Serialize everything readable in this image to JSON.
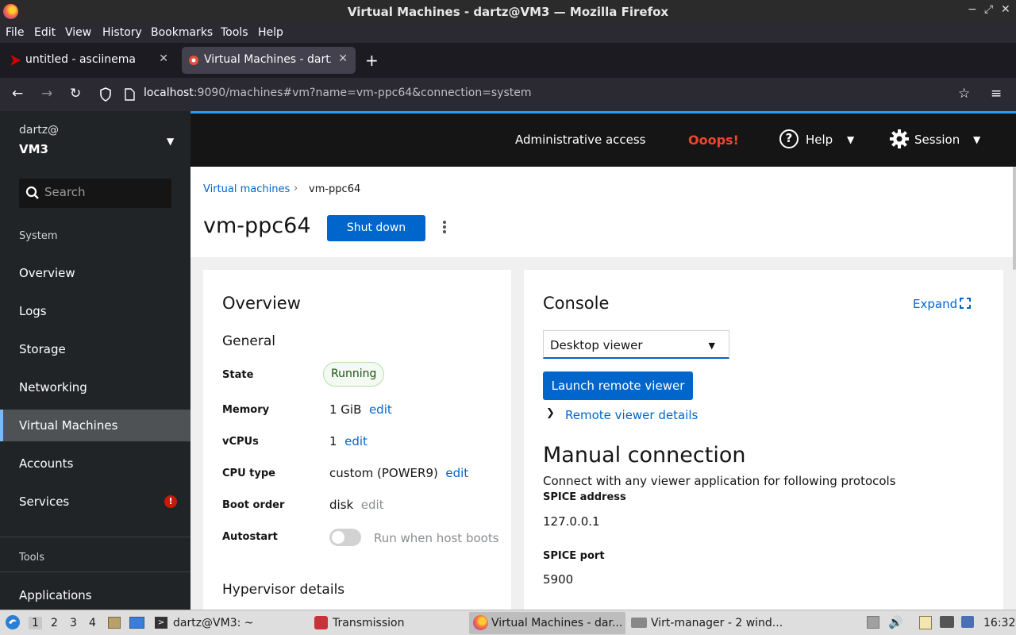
{
  "window": {
    "title": "Virtual Machines - dartz@VM3 — Mozilla Firefox",
    "controls": [
      "−",
      "⤢",
      "✕"
    ]
  },
  "menubar": [
    "File",
    "Edit",
    "View",
    "History",
    "Bookmarks",
    "Tools",
    "Help"
  ],
  "tabs": [
    {
      "label": "untitled - asciinema",
      "active": false
    },
    {
      "label": "Virtual Machines - dartz@",
      "active": true
    }
  ],
  "nav": {
    "url_host": "localhost",
    "url_rest": ":9090/machines#vm?name=vm-ppc64&connection=system"
  },
  "sidebar": {
    "user": "dartz@",
    "host": "VM3",
    "search_placeholder": "Search",
    "section_system": "System",
    "items": [
      "Overview",
      "Logs",
      "Storage",
      "Networking",
      "Virtual Machines",
      "Accounts",
      "Services"
    ],
    "active_item": "Virtual Machines",
    "services_alert": "!",
    "section_tools": "Tools",
    "tools_items": [
      "Applications"
    ]
  },
  "masthead": {
    "admin": "Administrative access",
    "oops": "Ooops!",
    "help": "Help",
    "session": "Session"
  },
  "page": {
    "breadcrumb_link": "Virtual machines",
    "breadcrumb_current": "vm-ppc64",
    "title": "vm-ppc64",
    "shutdown_button": "Shut down"
  },
  "overview": {
    "title": "Overview",
    "general": "General",
    "state_label": "State",
    "state_value": "Running",
    "memory_label": "Memory",
    "memory_value": "1 GiB",
    "vcpus_label": "vCPUs",
    "vcpus_value": "1",
    "cputype_label": "CPU type",
    "cputype_value": "custom (POWER9)",
    "boot_label": "Boot order",
    "boot_value": "disk",
    "autostart_label": "Autostart",
    "autostart_text": "Run when host boots",
    "edit": "edit",
    "hypervisor": "Hypervisor details"
  },
  "console": {
    "title": "Console",
    "expand": "Expand",
    "viewer_select": "Desktop viewer",
    "launch_button": "Launch remote viewer",
    "remote_details": "Remote viewer details",
    "manual_title": "Manual connection",
    "manual_desc": "Connect with any viewer application for following protocols",
    "spice_address_label": "SPICE address",
    "spice_address": "127.0.0.1",
    "spice_port_label": "SPICE port",
    "spice_port": "5900"
  },
  "taskbar": {
    "workspaces": [
      "1",
      "2",
      "3",
      "4"
    ],
    "terminal": "dartz@VM3: ~",
    "transmission": "Transmission",
    "firefox": "Virtual Machines - dar...",
    "virtmanager": "Virt-manager - 2 wind...",
    "clock": "16:32"
  },
  "colors": {
    "accent": "#0066cc",
    "sidebar_bg": "#212427",
    "masthead_bg": "#151515",
    "oops": "#f0442c"
  }
}
